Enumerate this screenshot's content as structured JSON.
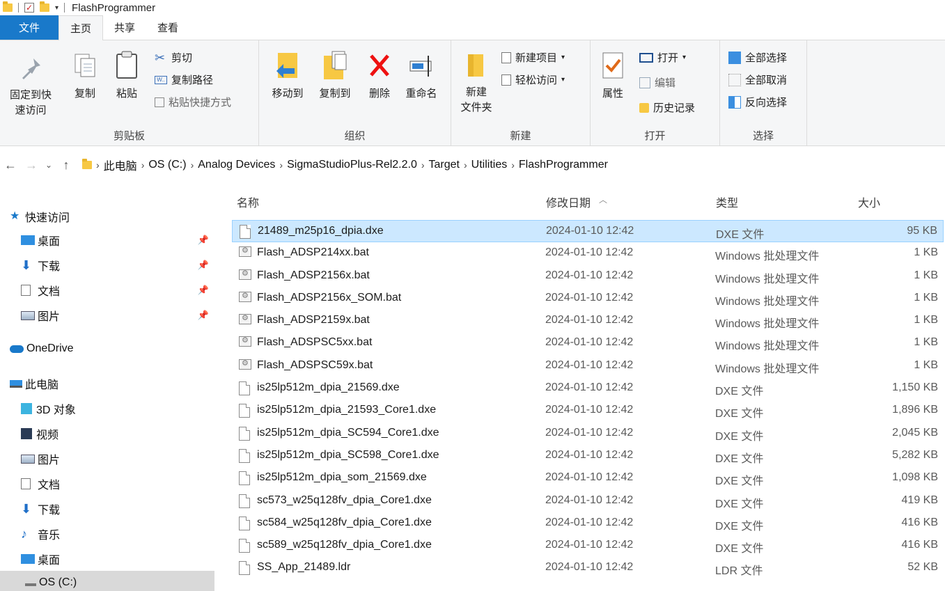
{
  "window": {
    "title": "FlashProgrammer"
  },
  "tabs": [
    "文件",
    "主页",
    "共享",
    "查看"
  ],
  "ribbon": {
    "clipboard": {
      "label": "剪贴板",
      "pin_line1": "固定到快",
      "pin_line2": "速访问",
      "copy": "复制",
      "paste": "粘贴",
      "cut": "剪切",
      "copy_path": "复制路径",
      "paste_shortcut": "粘贴快捷方式"
    },
    "organize": {
      "label": "组织",
      "move_to": "移动到",
      "copy_to": "复制到",
      "delete": "删除",
      "rename": "重命名"
    },
    "new": {
      "label": "新建",
      "new_folder_line1": "新建",
      "new_folder_line2": "文件夹",
      "new_item": "新建项目",
      "easy_access": "轻松访问"
    },
    "open": {
      "label": "打开",
      "properties": "属性",
      "open": "打开",
      "edit": "编辑",
      "history": "历史记录"
    },
    "select": {
      "label": "选择",
      "select_all": "全部选择",
      "select_none": "全部取消",
      "invert": "反向选择"
    }
  },
  "address": {
    "crumbs": [
      "此电脑",
      "OS (C:)",
      "Analog Devices",
      "SigmaStudioPlus-Rel2.2.0",
      "Target",
      "Utilities",
      "FlashProgrammer"
    ]
  },
  "sidebar": {
    "items": [
      {
        "label": "快速访问",
        "icon": "star-icon"
      },
      {
        "label": "桌面",
        "icon": "desktop-icon"
      },
      {
        "label": "下载",
        "icon": "download-icon"
      },
      {
        "label": "文档",
        "icon": "document-icon"
      },
      {
        "label": "图片",
        "icon": "pictures-icon"
      },
      {
        "label": "OneDrive",
        "icon": "cloud-icon"
      },
      {
        "label": "此电脑",
        "icon": "computer-icon"
      },
      {
        "label": "3D 对象",
        "icon": "cube-icon"
      },
      {
        "label": "视频",
        "icon": "video-icon"
      },
      {
        "label": "图片",
        "icon": "pictures-icon"
      },
      {
        "label": "文档",
        "icon": "document-icon"
      },
      {
        "label": "下载",
        "icon": "download-icon"
      },
      {
        "label": "音乐",
        "icon": "music-icon"
      },
      {
        "label": "桌面",
        "icon": "desktop-icon"
      },
      {
        "label": "OS (C:)",
        "icon": "drive-icon"
      }
    ]
  },
  "list": {
    "columns": {
      "name": "名称",
      "date": "修改日期",
      "type": "类型",
      "size": "大小"
    },
    "rows": [
      {
        "name": "21489_m25p16_dpia.dxe",
        "date": "2024-01-10 12:42",
        "type": "DXE 文件",
        "size": "95 KB",
        "kind": "file"
      },
      {
        "name": "Flash_ADSP214xx.bat",
        "date": "2024-01-10 12:42",
        "type": "Windows 批处理文件",
        "size": "1 KB",
        "kind": "bat"
      },
      {
        "name": "Flash_ADSP2156x.bat",
        "date": "2024-01-10 12:42",
        "type": "Windows 批处理文件",
        "size": "1 KB",
        "kind": "bat"
      },
      {
        "name": "Flash_ADSP2156x_SOM.bat",
        "date": "2024-01-10 12:42",
        "type": "Windows 批处理文件",
        "size": "1 KB",
        "kind": "bat"
      },
      {
        "name": "Flash_ADSP2159x.bat",
        "date": "2024-01-10 12:42",
        "type": "Windows 批处理文件",
        "size": "1 KB",
        "kind": "bat"
      },
      {
        "name": "Flash_ADSPSC5xx.bat",
        "date": "2024-01-10 12:42",
        "type": "Windows 批处理文件",
        "size": "1 KB",
        "kind": "bat"
      },
      {
        "name": "Flash_ADSPSC59x.bat",
        "date": "2024-01-10 12:42",
        "type": "Windows 批处理文件",
        "size": "1 KB",
        "kind": "bat"
      },
      {
        "name": "is25lp512m_dpia_21569.dxe",
        "date": "2024-01-10 12:42",
        "type": "DXE 文件",
        "size": "1,150 KB",
        "kind": "file"
      },
      {
        "name": "is25lp512m_dpia_21593_Core1.dxe",
        "date": "2024-01-10 12:42",
        "type": "DXE 文件",
        "size": "1,896 KB",
        "kind": "file"
      },
      {
        "name": "is25lp512m_dpia_SC594_Core1.dxe",
        "date": "2024-01-10 12:42",
        "type": "DXE 文件",
        "size": "2,045 KB",
        "kind": "file"
      },
      {
        "name": "is25lp512m_dpia_SC598_Core1.dxe",
        "date": "2024-01-10 12:42",
        "type": "DXE 文件",
        "size": "5,282 KB",
        "kind": "file"
      },
      {
        "name": "is25lp512m_dpia_som_21569.dxe",
        "date": "2024-01-10 12:42",
        "type": "DXE 文件",
        "size": "1,098 KB",
        "kind": "file"
      },
      {
        "name": "sc573_w25q128fv_dpia_Core1.dxe",
        "date": "2024-01-10 12:42",
        "type": "DXE 文件",
        "size": "419 KB",
        "kind": "file"
      },
      {
        "name": "sc584_w25q128fv_dpia_Core1.dxe",
        "date": "2024-01-10 12:42",
        "type": "DXE 文件",
        "size": "416 KB",
        "kind": "file"
      },
      {
        "name": "sc589_w25q128fv_dpia_Core1.dxe",
        "date": "2024-01-10 12:42",
        "type": "DXE 文件",
        "size": "416 KB",
        "kind": "file"
      },
      {
        "name": "SS_App_21489.ldr",
        "date": "2024-01-10 12:42",
        "type": "LDR 文件",
        "size": "52 KB",
        "kind": "file"
      }
    ]
  }
}
